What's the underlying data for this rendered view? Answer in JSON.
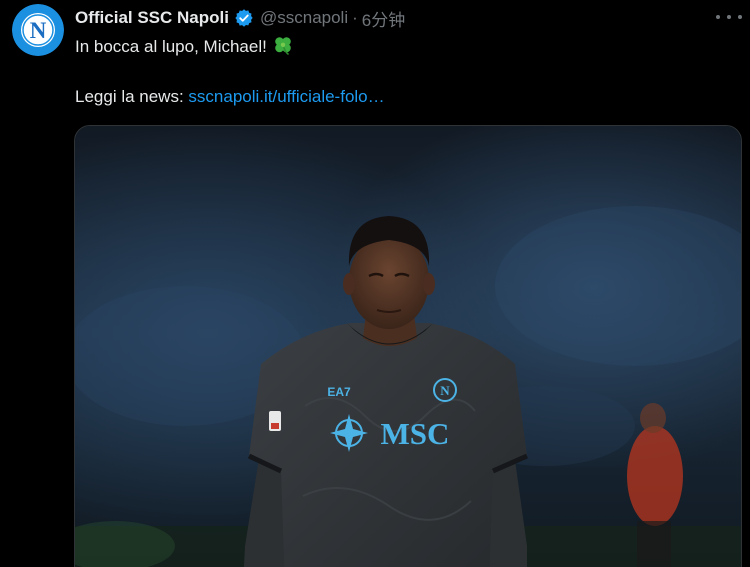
{
  "tweet": {
    "author_name": "Official SSC Napoli",
    "handle": "@sscnapoli",
    "separator": "·",
    "time": "6分钟",
    "text_line1": "In bocca al lupo, Michael!",
    "text_line2_prefix": "Leggi la news: ",
    "link_text": "sscnapoli.it/ufficiale-folo…"
  },
  "icons": {
    "avatar": "napoli-logo-icon",
    "verified": "verified-badge-icon",
    "clover": "four-leaf-clover-emoji",
    "more": "more-options-icon"
  },
  "avatar_letter": "N",
  "colors": {
    "background": "#000000",
    "text_primary": "#e7e9ea",
    "text_secondary": "#71767b",
    "link": "#1d9bf0",
    "verified": "#1d9bf0",
    "napoli_blue": "#1b8fe0"
  },
  "media": {
    "jersey_sponsor": "MSC",
    "jersey_brand": "EA7",
    "badge_letter": "N"
  }
}
